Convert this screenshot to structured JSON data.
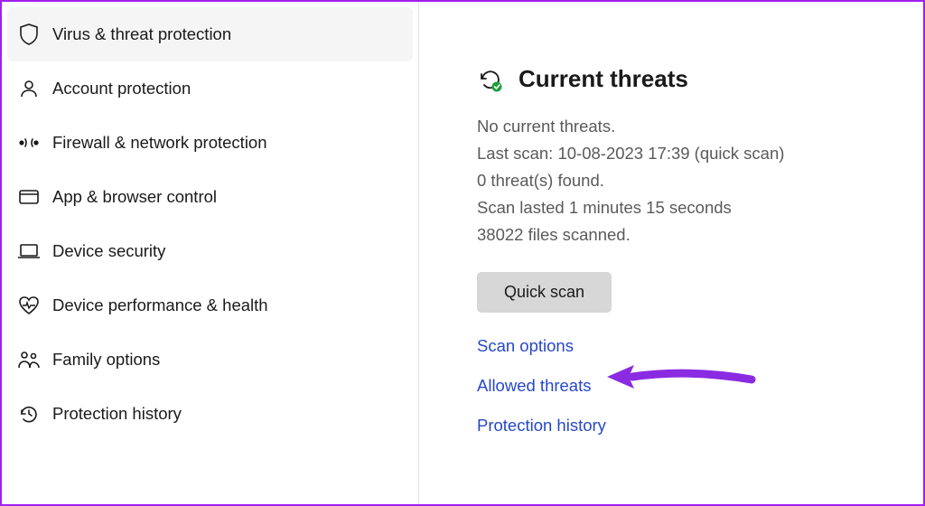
{
  "sidebar": {
    "items": [
      {
        "id": "virus-threat",
        "label": "Virus & threat protection"
      },
      {
        "id": "account",
        "label": "Account protection"
      },
      {
        "id": "firewall",
        "label": "Firewall & network protection"
      },
      {
        "id": "app-browser",
        "label": "App & browser control"
      },
      {
        "id": "device-security",
        "label": "Device security"
      },
      {
        "id": "device-perf",
        "label": "Device performance & health"
      },
      {
        "id": "family",
        "label": "Family options"
      },
      {
        "id": "history",
        "label": "Protection history"
      }
    ]
  },
  "threats": {
    "title": "Current threats",
    "status": "No current threats.",
    "lastScan": "Last scan: 10-08-2023 17:39 (quick scan)",
    "found": "0 threat(s) found.",
    "duration": "Scan lasted 1 minutes 15 seconds",
    "filesScanned": "38022 files scanned.",
    "quickScanLabel": "Quick scan",
    "links": {
      "scanOptions": "Scan options",
      "allowedThreats": "Allowed threats",
      "protectionHistory": "Protection history"
    }
  }
}
